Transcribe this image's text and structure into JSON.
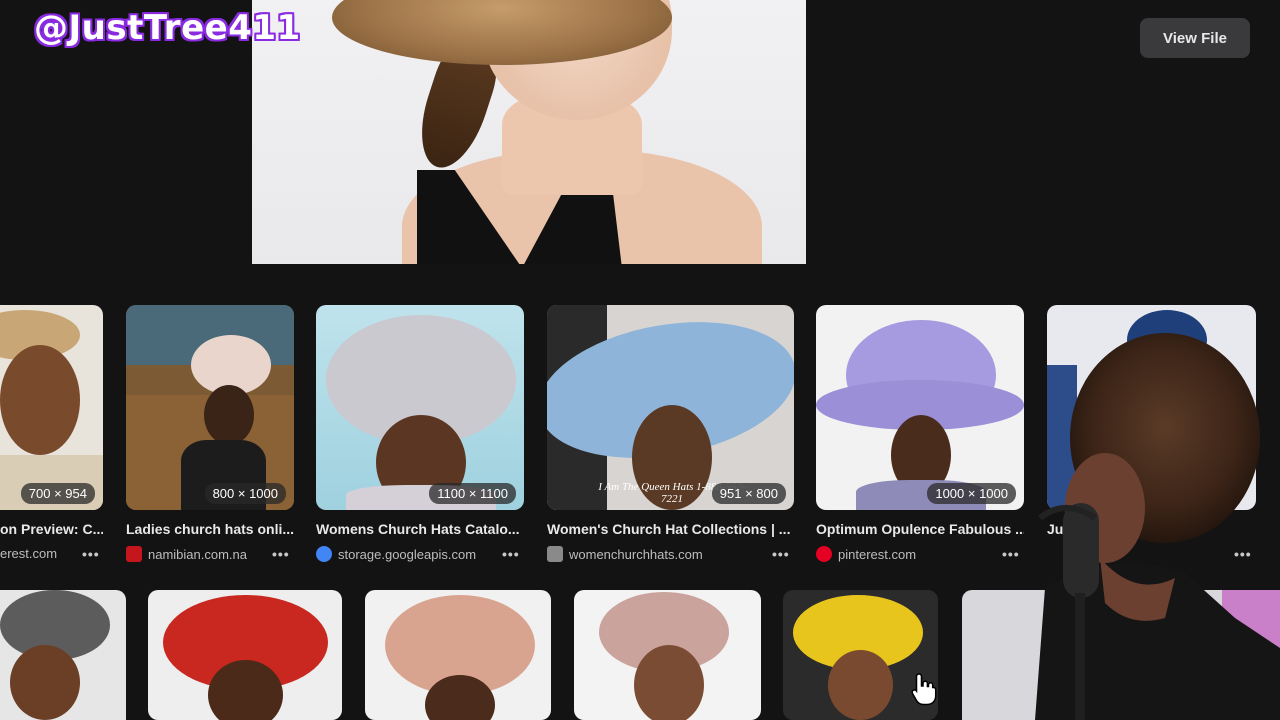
{
  "watermark": "@JustTree411",
  "header": {
    "view_file_label": "View File"
  },
  "results": [
    {
      "title": "on Preview: C...",
      "source": "erest.com",
      "dims": "700 × 954",
      "favicon_color": "#e60023"
    },
    {
      "title": "Ladies church hats onli...",
      "source": "namibian.com.na",
      "dims": "800 × 1000",
      "favicon_color": "#c4161c"
    },
    {
      "title": "Womens Church Hats Catalo...",
      "source": "storage.googleapis.com",
      "dims": "1100 × 1100",
      "favicon_color": "#4285f4"
    },
    {
      "title": "Women's Church Hat Collections | ...",
      "source": "womenchurchhats.com",
      "dims": "951 × 800",
      "favicon_color": "#8a8a8a",
      "overlay_text": "I Am The Queen Hats 1-888-552-7221"
    },
    {
      "title": "Optimum Opulence Fabulous ...",
      "source": "pinterest.com",
      "dims": "1000 × 1000",
      "favicon_color": "#e60023"
    },
    {
      "title": "Ju...",
      "source": "",
      "dims": "",
      "favicon_color": "#e60023"
    }
  ],
  "more_label": "•••"
}
